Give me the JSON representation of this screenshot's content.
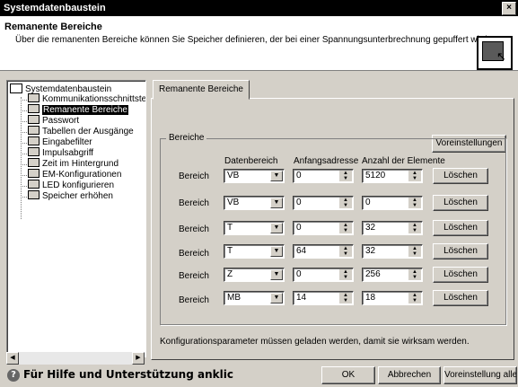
{
  "window": {
    "title": "Systemdatenbaustein",
    "close_label": "×"
  },
  "header": {
    "title": "Remanente Bereiche",
    "description": "Über die remanenten Bereiche können Sie Speicher definieren, der bei einer Spannungsunterbrechnung gepuffert wird."
  },
  "tree": {
    "root": "Systemdatenbaustein",
    "items": [
      "Kommunikationsschnittstell",
      "Remanente Bereiche",
      "Passwort",
      "Tabellen der Ausgänge",
      "Eingabefilter",
      "Impulsabgriff",
      "Zeit im Hintergrund",
      "EM-Konfigurationen",
      "LED konfigurieren",
      "Speicher erhöhen"
    ],
    "selected_index": 1
  },
  "tab": {
    "label": "Remanente Bereiche"
  },
  "panel": {
    "defaults_button": "Voreinstellungen",
    "group_label": "Bereiche",
    "columns": {
      "datenbereich": "Datenbereich",
      "anfangsadresse": "Anfangsadresse",
      "anzahl": "Anzahl der Elemente"
    },
    "rows": [
      {
        "label": "Bereich",
        "area": "VB",
        "start": "0",
        "count": "5120",
        "delete": "Löschen"
      },
      {
        "label": "Bereich",
        "area": "VB",
        "start": "0",
        "count": "0",
        "delete": "Löschen"
      },
      {
        "label": "Bereich",
        "area": "T",
        "start": "0",
        "count": "32",
        "delete": "Löschen"
      },
      {
        "label": "Bereich",
        "area": "T",
        "start": "64",
        "count": "32",
        "delete": "Löschen"
      },
      {
        "label": "Bereich",
        "area": "Z",
        "start": "0",
        "count": "256",
        "delete": "Löschen"
      },
      {
        "label": "Bereich",
        "area": "MB",
        "start": "14",
        "count": "18",
        "delete": "Löschen"
      }
    ],
    "note": "Konfigurationsparameter müssen geladen werden, damit sie wirksam werden."
  },
  "footer": {
    "help_text": "Für Hilfe und Unterstützung anklic",
    "ok": "OK",
    "cancel": "Abbrechen",
    "defaults_all": "Voreinstellung alle"
  }
}
